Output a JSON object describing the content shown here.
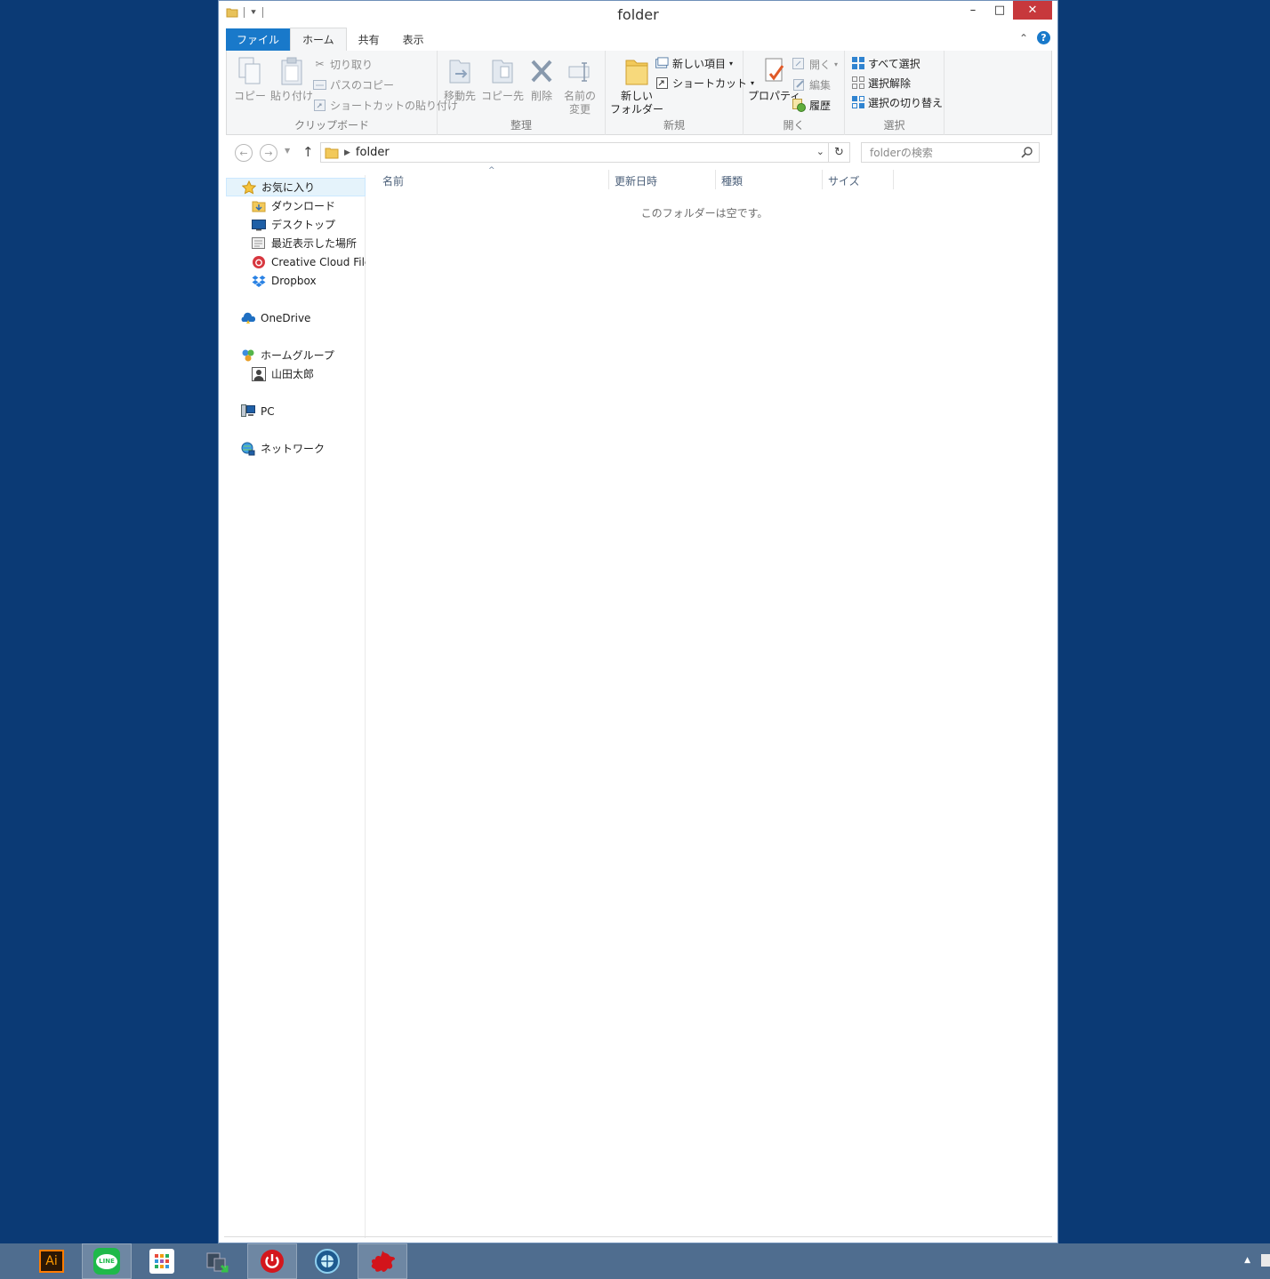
{
  "window": {
    "title": "folder",
    "minimize": "–",
    "maximize": "□",
    "close": "✕"
  },
  "ribbon_tabs": [
    "ファイル",
    "ホーム",
    "共有",
    "表示"
  ],
  "help_label": "?",
  "ribbon": {
    "clipboard": {
      "label": "クリップボード",
      "copy": "コピー",
      "paste": "貼り付け",
      "cut": "切り取り",
      "copy_path": "パスのコピー",
      "paste_shortcut": "ショートカットの貼り付け"
    },
    "organize": {
      "label": "整理",
      "move_to": "移動先",
      "copy_to": "コピー先",
      "delete": "削除",
      "rename_1": "名前の",
      "rename_2": "変更"
    },
    "new": {
      "label": "新規",
      "new_folder_1": "新しい",
      "new_folder_2": "フォルダー",
      "new_item": "新しい項目",
      "shortcut": "ショートカット"
    },
    "open": {
      "label": "開く",
      "properties": "プロパティ",
      "open": "開く",
      "edit": "編集",
      "history": "履歴"
    },
    "select": {
      "label": "選択",
      "select_all": "すべて選択",
      "select_none": "選択解除",
      "invert": "選択の切り替え"
    }
  },
  "address": {
    "path": "folder",
    "search_placeholder": "folderの検索"
  },
  "nav_pane": {
    "favorites": "お気に入り",
    "downloads": "ダウンロード",
    "desktop": "デスクトップ",
    "recent": "最近表示した場所",
    "creative_cloud": "Creative Cloud Files",
    "dropbox": "Dropbox",
    "onedrive": "OneDrive",
    "homegroup": "ホームグループ",
    "user": "山田太郎",
    "pc": "PC",
    "network": "ネットワーク"
  },
  "columns": {
    "name": "名前",
    "modified": "更新日時",
    "type": "種類",
    "size": "サイズ"
  },
  "empty_message": "このフォルダーは空です。",
  "taskbar": {
    "ai_label": "Ai",
    "line_label": "LINE"
  },
  "colors": {
    "desktop": "#0b3a75",
    "accent": "#1979ca",
    "close": "#c7383c",
    "taskbar": "#4f6d8f"
  }
}
